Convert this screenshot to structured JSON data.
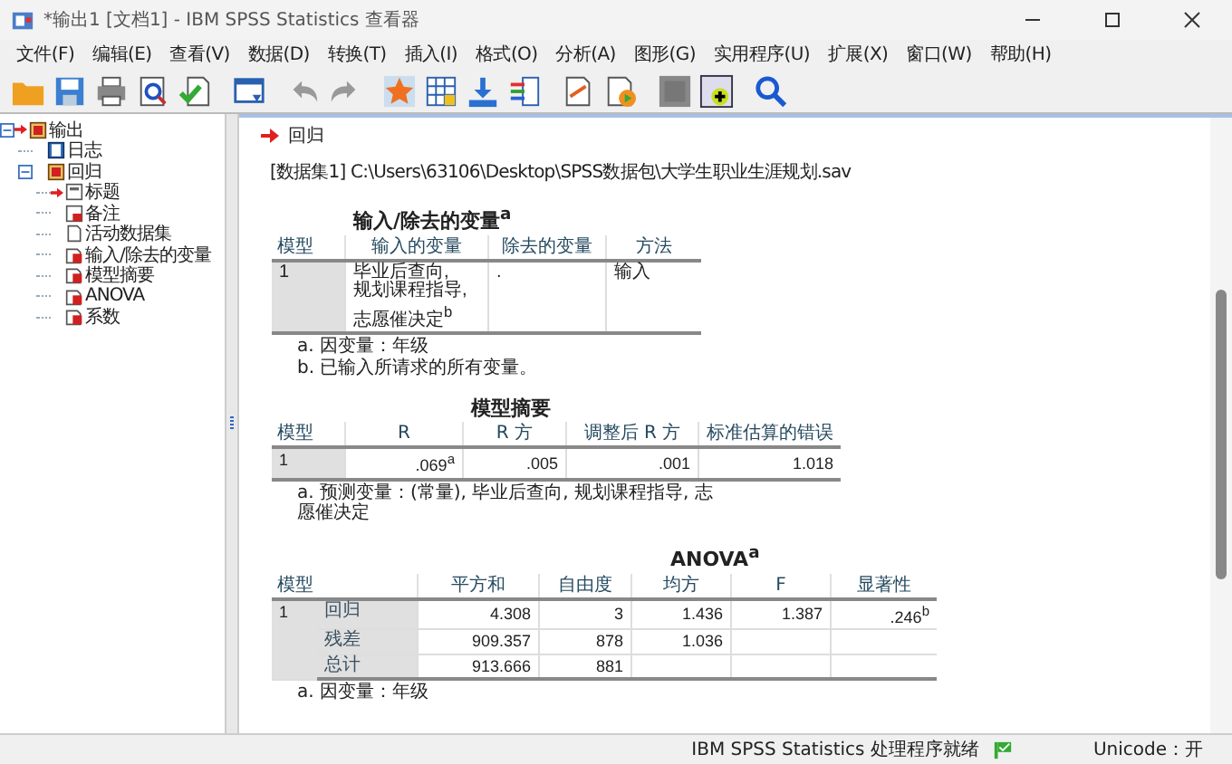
{
  "window": {
    "title": "*输出1 [文档1] - IBM SPSS Statistics 查看器"
  },
  "menu": [
    "文件(F)",
    "编辑(E)",
    "查看(V)",
    "数据(D)",
    "转换(T)",
    "插入(I)",
    "格式(O)",
    "分析(A)",
    "图形(G)",
    "实用程序(U)",
    "扩展(X)",
    "窗口(W)",
    "帮助(H)"
  ],
  "tree": [
    {
      "label": "输出",
      "kind": "node",
      "current": true,
      "expanded": true,
      "children": [
        {
          "label": "日志",
          "kind": "log",
          "current": false
        },
        {
          "label": "回归",
          "kind": "node",
          "current": false,
          "expanded": true,
          "children": [
            {
              "label": "标题",
              "kind": "title",
              "current": true
            },
            {
              "label": "备注",
              "kind": "note",
              "current": false
            },
            {
              "label": "活动数据集",
              "kind": "page",
              "current": false
            },
            {
              "label": "输入/除去的变量",
              "kind": "table",
              "current": false
            },
            {
              "label": "模型摘要",
              "kind": "table",
              "current": false
            },
            {
              "label": "ANOVA",
              "kind": "table",
              "current": false
            },
            {
              "label": "系数",
              "kind": "table",
              "current": false
            }
          ]
        }
      ]
    }
  ],
  "content": {
    "heading": "回归",
    "dataset": "[数据集1] C:\\Users\\63106\\Desktop\\SPSS数据包\\大学生职业生涯规划.sav",
    "tables": [
      {
        "kind": "simple",
        "title": "输入/除去的变量$^{a}$",
        "columns": [
          "模型",
          "输入的变量",
          "除去的变量",
          "方法"
        ],
        "rows": [
          [
            "1",
            "毕业后查向,\n规划课程指导,\n志愿催决定$^{b}$",
            ".",
            "输入"
          ]
        ],
        "footnotes": [
          "a. 因变量：年级",
          "b. 已输入所请求的所有变量。"
        ]
      },
      {
        "kind": "simple",
        "title": "模型摘要",
        "columns": [
          "模型",
          "R",
          "R 方",
          "调整后 R 方",
          "标准估算的错误"
        ],
        "rows": [
          [
            "1",
            ".069$^{a}$",
            ".005",
            ".001",
            "1.018"
          ]
        ],
        "footnotes": [
          "a. 预测变量：(常量), 毕业后查向, 规划课程指导, 志愿催决定"
        ]
      },
      {
        "kind": "grouped",
        "title": "ANOVA$^{a}$",
        "columns": [
          "模型",
          "平方和",
          "自由度",
          "均方",
          "F",
          "显著性"
        ],
        "group": "1",
        "rows": [
          [
            "回归",
            "4.308",
            "3",
            "1.436",
            "1.387",
            ".246$^{b}$"
          ],
          [
            "残差",
            "909.357",
            "878",
            "1.036"
          ],
          [
            "总计",
            "913.666",
            "881"
          ]
        ],
        "footnotes": [
          "a. 因变量：年级"
        ]
      }
    ]
  },
  "status_bar": {
    "processor": "IBM SPSS Statistics 处理程序就绪",
    "unicode": "Unicode：开"
  }
}
